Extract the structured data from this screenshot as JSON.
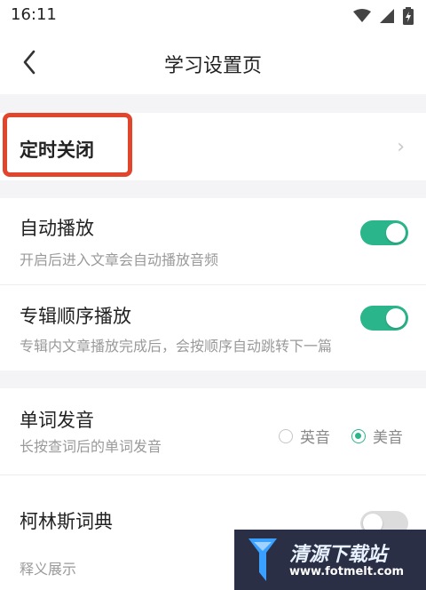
{
  "status_bar": {
    "time": "16:11"
  },
  "header": {
    "title": "学习设置页"
  },
  "sections": {
    "timer": {
      "title": "定时关闭"
    },
    "autoplay": {
      "title": "自动播放",
      "desc": "开启后进入文章会自动播放音频",
      "enabled": true
    },
    "album_order": {
      "title": "专辑顺序播放",
      "desc": "专辑内文章播放完成后，会按顺序自动跳转下一篇",
      "enabled": true
    },
    "pronunciation": {
      "title": "单词发音",
      "desc": "长按查词后的单词发音",
      "options": [
        "英音",
        "美音"
      ],
      "selected": "美音"
    },
    "collins": {
      "title": "柯林斯词典",
      "desc": "释义展示",
      "enabled": false
    }
  },
  "watermark": {
    "title": "清源下载站",
    "url": "www.fotmelt.com"
  },
  "colors": {
    "accent": "#2bb58a",
    "highlight": "#e1452b",
    "toggle_off": "#dcdcdc"
  }
}
